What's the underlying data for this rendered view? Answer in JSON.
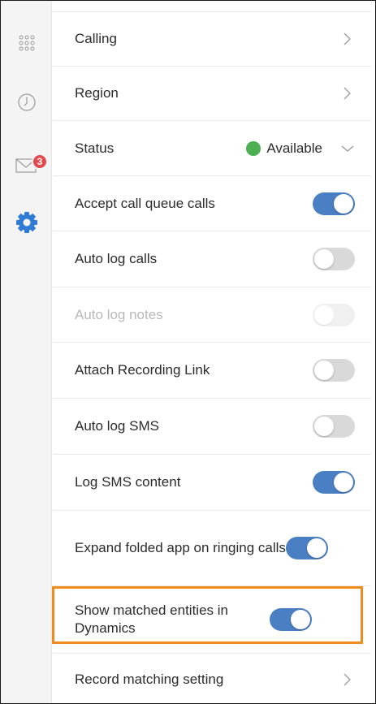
{
  "sidebar": {
    "icons": [
      "dialpad-icon",
      "history-clock-icon",
      "messages-envelope-icon",
      "settings-gear-icon"
    ],
    "messages_badge": "3",
    "active_color": "#2f7bd6"
  },
  "settings": {
    "calling": {
      "label": "Calling"
    },
    "region": {
      "label": "Region"
    },
    "status": {
      "label": "Status",
      "value": "Available",
      "color": "#4caf50"
    },
    "accept_queue": {
      "label": "Accept call queue calls",
      "state": "on"
    },
    "auto_log_calls": {
      "label": "Auto log calls",
      "state": "off"
    },
    "auto_log_notes": {
      "label": "Auto log notes",
      "state": "disabled"
    },
    "attach_recording": {
      "label": "Attach Recording Link",
      "state": "off"
    },
    "auto_log_sms": {
      "label": "Auto log SMS",
      "state": "off"
    },
    "log_sms_content": {
      "label": "Log SMS content",
      "state": "on"
    },
    "expand_folded": {
      "label": "Expand folded app on ringing calls",
      "state": "on"
    },
    "show_matched": {
      "label": "Show matched entities in Dynamics",
      "state": "on"
    },
    "record_matching": {
      "label": "Record matching setting"
    }
  },
  "colors": {
    "toggle_on": "#4a7fc4",
    "highlight": "#f08c1d",
    "badge": "#e5484d"
  }
}
